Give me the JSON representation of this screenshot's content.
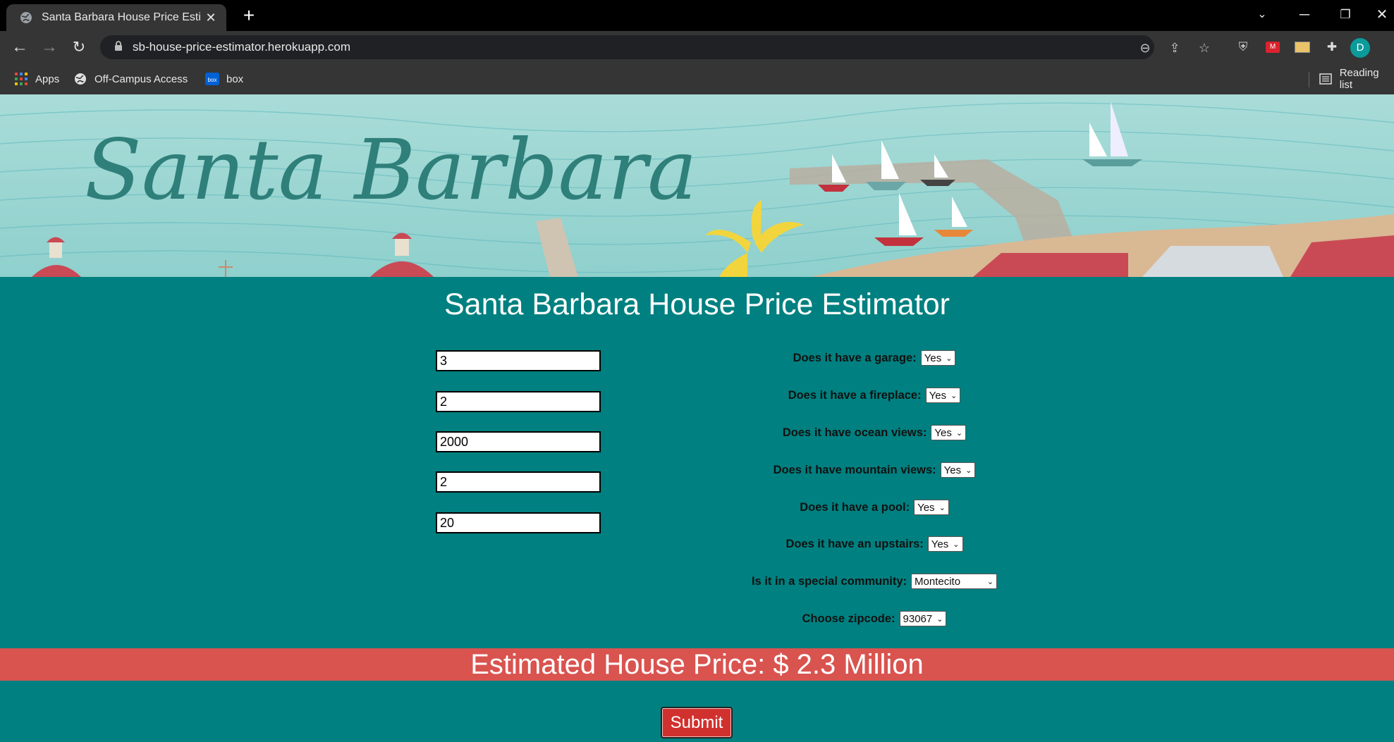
{
  "browser": {
    "tab_title": "Santa Barbara House Price Estim",
    "url": "sb-house-price-estimator.herokuapp.com",
    "avatar_letter": "D",
    "bookmarks": [
      {
        "label": "Apps",
        "icon": "apps-grid-icon"
      },
      {
        "label": "Off-Campus Access",
        "icon": "globe-icon"
      },
      {
        "label": "box",
        "icon": "box-logo-icon"
      }
    ],
    "reading_list_label": "Reading list"
  },
  "banner": {
    "script_text": "Santa Barbara"
  },
  "page": {
    "title": "Santa Barbara House Price Estimator",
    "numeric_inputs": [
      "3",
      "2",
      "2000",
      "2",
      "20"
    ],
    "questions": [
      {
        "label": "Does it have a garage:",
        "value": "Yes"
      },
      {
        "label": "Does it have a fireplace:",
        "value": "Yes"
      },
      {
        "label": "Does it have ocean views:",
        "value": "Yes"
      },
      {
        "label": "Does it have mountain views:",
        "value": "Yes"
      },
      {
        "label": "Does it have a pool:",
        "value": "Yes"
      },
      {
        "label": "Does it have an upstairs:",
        "value": "Yes"
      },
      {
        "label": "Is it in a special community:",
        "value": "Montecito"
      },
      {
        "label": "Choose zipcode:",
        "value": "93067"
      }
    ],
    "result": "Estimated House Price: $ 2.3 Million",
    "submit_label": "Submit"
  },
  "colors": {
    "page_background": "#008080",
    "result_bar": "#d9534f",
    "submit_button": "#d1312e"
  }
}
